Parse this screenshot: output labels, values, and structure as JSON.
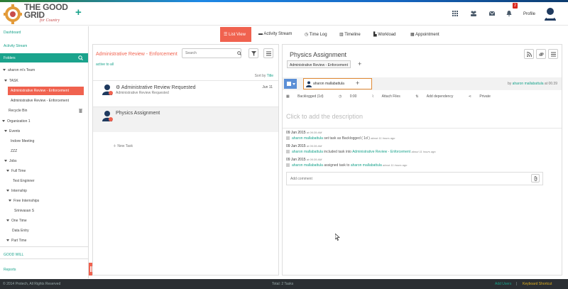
{
  "brand": {
    "title_line1": "THE GOOD",
    "title_line2": "GRID",
    "tagline": "for Country"
  },
  "topbar": {
    "notification_count": "2",
    "profile_label": "Profile"
  },
  "sidebar": {
    "dashboard": "Dashboard",
    "activity_stream": "Activity Stream",
    "folders": "Folders",
    "tree": {
      "team": "aharon m's Team",
      "task": "TASK",
      "admin_review_selected": "Administrative Review - Enforcement",
      "admin_review": "Administrative Review - Enforcement",
      "recycle_bin": "Recycle Bin",
      "organization": "Organization 1",
      "events": "Events",
      "indore_meeting": "Indore Meeting",
      "zzz": "ZZZ",
      "jobs": "Jobs",
      "full_time": "Full Time",
      "test_enginner": "Test Enginner",
      "internship": "Internship",
      "free_internships": "Free Internships",
      "srinivasan": "Srinivasan S",
      "one_time": "One Time",
      "data_entry": "Data Entry",
      "part_time": "Part Time"
    },
    "good_will": "GOOD WILL",
    "reports": "Reports"
  },
  "view_tabs": [
    {
      "label": "List View"
    },
    {
      "label": "Activity Stream"
    },
    {
      "label": "Time Log"
    },
    {
      "label": "Timeline"
    },
    {
      "label": "Workload"
    },
    {
      "label": "Appointment"
    }
  ],
  "list": {
    "title": "Administrative Review - Enforcement",
    "search_placeholder": "Search",
    "filter_active": "active",
    "filter_all": "to all",
    "sort_label": "Sort by",
    "sort_value": "Title",
    "tasks": [
      {
        "title": "Administrative Review Requested",
        "sub": "Administrative Review Requested",
        "date": "Jun 11"
      },
      {
        "title": "Physics Assignment",
        "sub": "",
        "date": ""
      }
    ],
    "new_task": "New Task"
  },
  "detail": {
    "title": "Physics Assignment",
    "folder_tag": "Administrative Review - Enforcement",
    "assignee": "aharon mallabattula",
    "created_by_prefix": "by",
    "created_by_user": "aharon mallabattula",
    "created_at": "at 06:39",
    "meta": {
      "backlogged": "Backlogged (1d)",
      "time": "0:00",
      "attach": "Attach Files",
      "dependency": "Add dependency",
      "private": "Private"
    },
    "description_placeholder": "Click to add the description",
    "activities": [
      {
        "date": "09 Jun 2015",
        "time": "at 06:39 AM",
        "user": "aharon mallabattula",
        "text": "set task as Backlogged ( 1d )",
        "ago": "about 11 hours ago"
      },
      {
        "date": "09 Jun 2015",
        "time": "at 06:39 AM",
        "user": "aharon mallabattula",
        "text": "included task into",
        "target": "Administrative Review - Enforcement",
        "ago": "about 11 hours ago"
      },
      {
        "date": "09 Jun 2015",
        "time": "at 06:39 AM",
        "user": "aharon mallabattula",
        "text": "assigned task to",
        "target": "aharon mallabattula",
        "ago": "about 11 hours ago"
      }
    ],
    "comment_placeholder": "Add comment"
  },
  "footer": {
    "copyright": "© 2014 Protech, All Rights Reserved",
    "total": "Total: 2 Tasks",
    "add_users": "Add Users",
    "sep": "|",
    "shortcut": "Keyboard Shortcut"
  },
  "colors": {
    "accent": "#f0624f",
    "teal": "#1aa38c",
    "footer": "#2b2f33",
    "status": "#5b8fd6"
  }
}
